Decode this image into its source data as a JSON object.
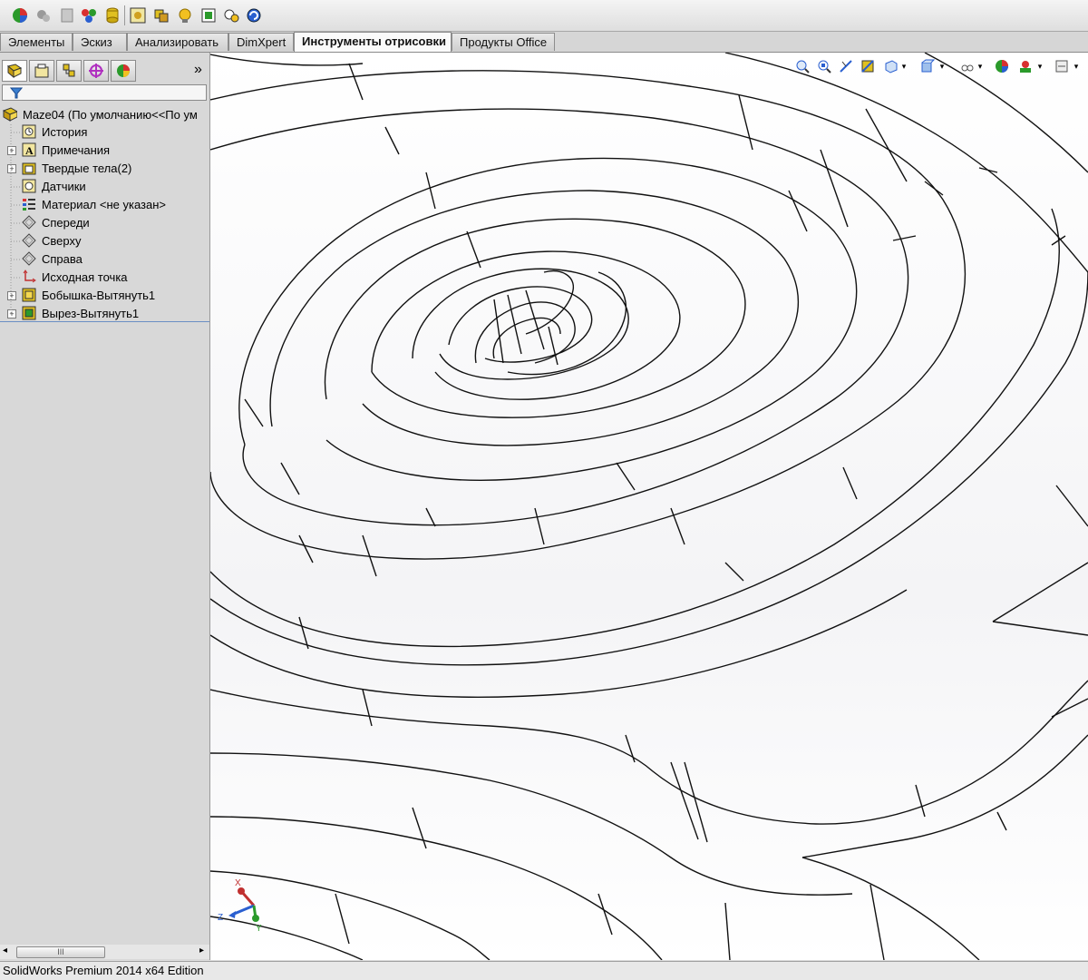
{
  "toolbar": {
    "icons": [
      "appearance-icon",
      "rebuild-icon",
      "options-icon",
      "display-manager-icon",
      "database-icon",
      "explode-icon",
      "component-icon",
      "bulb-icon",
      "view-icon",
      "camera-icon",
      "rotate-icon"
    ]
  },
  "tabs": [
    {
      "label": "Элементы",
      "active": false
    },
    {
      "label": "Эскиз",
      "active": false
    },
    {
      "label": "Анализировать",
      "active": false
    },
    {
      "label": "DimXpert",
      "active": false
    },
    {
      "label": "Инструменты отрисовки",
      "active": true
    },
    {
      "label": "Продукты Office",
      "active": false
    }
  ],
  "panel": {
    "more_glyph": "»",
    "tree": {
      "root": "Maze04  (По умолчанию<<По ум",
      "items": [
        {
          "label": "История",
          "icon": "history-icon",
          "expandable": false
        },
        {
          "label": "Примечания",
          "icon": "annotations-icon",
          "expandable": true
        },
        {
          "label": "Твердые тела(2)",
          "icon": "solid-bodies-icon",
          "expandable": true
        },
        {
          "label": "Датчики",
          "icon": "sensors-icon",
          "expandable": false
        },
        {
          "label": "Материал <не указан>",
          "icon": "material-icon",
          "expandable": false
        },
        {
          "label": "Спереди",
          "icon": "plane-icon",
          "expandable": false
        },
        {
          "label": "Сверху",
          "icon": "plane-icon",
          "expandable": false
        },
        {
          "label": "Справа",
          "icon": "plane-icon",
          "expandable": false
        },
        {
          "label": "Исходная точка",
          "icon": "origin-icon",
          "expandable": false
        },
        {
          "label": "Бобышка-Вытянуть1",
          "icon": "boss-extrude-icon",
          "expandable": true
        },
        {
          "label": "Вырез-Вытянуть1",
          "icon": "cut-extrude-icon",
          "expandable": true
        }
      ]
    },
    "scroll_glyph": "III"
  },
  "triad": {
    "x": "X",
    "y": "Y",
    "z": "Z"
  },
  "status": {
    "text": "SolidWorks Premium 2014 x64 Edition"
  },
  "colors": {
    "accent": "#6b8fc4",
    "viewport_bg": "#ffffff",
    "edge": "#111111"
  }
}
